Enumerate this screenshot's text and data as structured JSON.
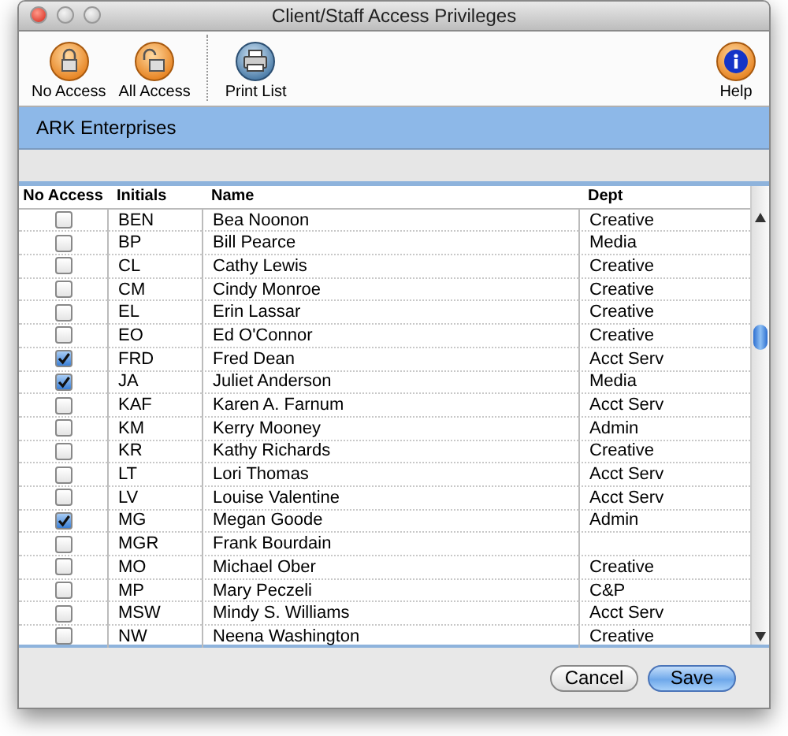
{
  "window": {
    "title": "Client/Staff Access Privileges"
  },
  "toolbar": [
    {
      "kind": "lock",
      "label": "No Access"
    },
    {
      "kind": "unlock",
      "label": "All Access"
    },
    {
      "kind": "print",
      "label": "Print List"
    },
    {
      "kind": "help",
      "label": "Help"
    }
  ],
  "company": "ARK Enterprises",
  "table": {
    "columns": [
      "No Access",
      "Initials",
      "Name",
      "Dept"
    ],
    "rows": [
      {
        "checked": false,
        "initials": "BEN",
        "name": "Bea Noonon",
        "dept": "Creative"
      },
      {
        "checked": false,
        "initials": "BP",
        "name": "Bill Pearce",
        "dept": "Media"
      },
      {
        "checked": false,
        "initials": "CL",
        "name": "Cathy Lewis",
        "dept": "Creative"
      },
      {
        "checked": false,
        "initials": "CM",
        "name": "Cindy Monroe",
        "dept": "Creative"
      },
      {
        "checked": false,
        "initials": "EL",
        "name": "Erin Lassar",
        "dept": "Creative"
      },
      {
        "checked": false,
        "initials": "EO",
        "name": "Ed O'Connor",
        "dept": "Creative"
      },
      {
        "checked": true,
        "initials": "FRD",
        "name": "Fred Dean",
        "dept": "Acct Serv"
      },
      {
        "checked": true,
        "initials": "JA",
        "name": "Juliet Anderson",
        "dept": "Media"
      },
      {
        "checked": false,
        "initials": "KAF",
        "name": "Karen A. Farnum",
        "dept": "Acct Serv"
      },
      {
        "checked": false,
        "initials": "KM",
        "name": "Kerry Mooney",
        "dept": "Admin"
      },
      {
        "checked": false,
        "initials": "KR",
        "name": "Kathy Richards",
        "dept": "Creative"
      },
      {
        "checked": false,
        "initials": "LT",
        "name": "Lori Thomas",
        "dept": "Acct Serv"
      },
      {
        "checked": false,
        "initials": "LV",
        "name": "Louise Valentine",
        "dept": "Acct Serv"
      },
      {
        "checked": true,
        "initials": "MG",
        "name": "Megan Goode",
        "dept": "Admin"
      },
      {
        "checked": false,
        "initials": "MGR",
        "name": "Frank Bourdain"
      },
      {
        "checked": false,
        "initials": "MO",
        "name": "Michael Ober",
        "dept": "Creative"
      },
      {
        "checked": false,
        "initials": "MP",
        "name": "Mary Peczeli",
        "dept": "C&P"
      },
      {
        "checked": false,
        "initials": "MSW",
        "name": "Mindy S. Williams",
        "dept": "Acct Serv"
      },
      {
        "checked": false,
        "initials": "NW",
        "name": "Neena Washington",
        "dept": "Creative"
      }
    ]
  },
  "buttons": [
    {
      "kind": "cancel",
      "label": "Cancel"
    },
    {
      "kind": "save",
      "label": "Save"
    }
  ]
}
